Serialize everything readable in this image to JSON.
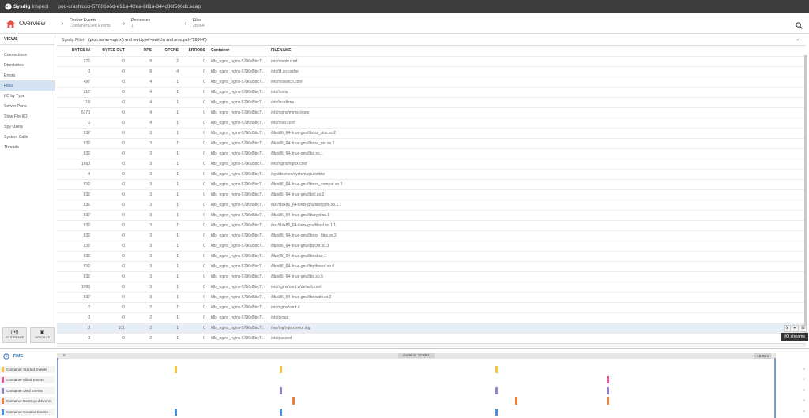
{
  "app": {
    "brand": "Sysdig",
    "subtitle": "Inspect",
    "filename": "pod-crashloop-57006e6d-e91a-42ea-881a-344c06f506dc.scap"
  },
  "nav": {
    "home_label": "Overview",
    "crumbs": [
      {
        "title": "Docker Events",
        "sub": "Container Died Events"
      },
      {
        "title": "Processes",
        "sub": "1"
      },
      {
        "title": "Files",
        "sub": "28064"
      }
    ]
  },
  "sidebar": {
    "header": "VIEWS",
    "items": [
      "Connections",
      "Directories",
      "Errors",
      "Files",
      "I/O by Type",
      "Server Ports",
      "Slow File I/O",
      "Spy Users",
      "System Calls",
      "Threads"
    ],
    "active_index": 3,
    "buttons": [
      {
        "glyph": "((•))",
        "label": "I/O STREAMS"
      },
      {
        "glyph": "▣",
        "label": "SYSCALLS"
      }
    ]
  },
  "filter": {
    "label": "Sysdig Filter",
    "value": "(proc.name=nginx ) and (evt.type!=switch) and proc.pid=\"28064\")"
  },
  "table": {
    "columns": [
      "BYTES IN",
      "BYTES OUT",
      "OPS",
      "OPENS",
      "ERRORS",
      "Container",
      "FILENAME"
    ],
    "rows": [
      [
        "276",
        "0",
        "8",
        "2",
        "0",
        "k8s_nginx_nginx-5796d5bc7...",
        "/etc/resolv.conf"
      ],
      [
        "0",
        "0",
        "8",
        "4",
        "0",
        "k8s_nginx_nginx-5796d5bc7...",
        "/etc/ld.so.cache"
      ],
      [
        "497",
        "0",
        "4",
        "1",
        "0",
        "k8s_nginx_nginx-5796d5bc7...",
        "/etc/nsswitch.conf"
      ],
      [
        "217",
        "0",
        "4",
        "1",
        "0",
        "k8s_nginx_nginx-5796d5bc7...",
        "/etc/hosts"
      ],
      [
        "118",
        "0",
        "4",
        "1",
        "0",
        "k8s_nginx_nginx-5796d5bc7...",
        "/etc/localtime"
      ],
      [
        "5170",
        "0",
        "4",
        "1",
        "0",
        "k8s_nginx_nginx-5796d5bc7...",
        "/etc/nginx/mime.types"
      ],
      [
        "0",
        "0",
        "4",
        "1",
        "0",
        "k8s_nginx_nginx-5796d5bc7...",
        "/etc/host.conf"
      ],
      [
        "832",
        "0",
        "3",
        "1",
        "0",
        "k8s_nginx_nginx-5796d5bc7...",
        "/lib/x86_64-linux-gnu/libnss_dns.so.2"
      ],
      [
        "832",
        "0",
        "3",
        "1",
        "0",
        "k8s_nginx_nginx-5796d5bc7...",
        "/lib/x86_64-linux-gnu/libnss_nis.so.2"
      ],
      [
        "832",
        "0",
        "3",
        "1",
        "0",
        "k8s_nginx_nginx-5796d5bc7...",
        "/lib/x86_64-linux-gnu/libz.so.1"
      ],
      [
        "1680",
        "0",
        "3",
        "1",
        "0",
        "k8s_nginx_nginx-5796d5bc7...",
        "/etc/nginx/nginx.conf"
      ],
      [
        "4",
        "0",
        "3",
        "1",
        "0",
        "k8s_nginx_nginx-5796d5bc7...",
        "/sys/devices/system/cpu/online"
      ],
      [
        "832",
        "0",
        "3",
        "1",
        "0",
        "k8s_nginx_nginx-5796d5bc7...",
        "/lib/x86_64-linux-gnu/libnss_compat.so.2"
      ],
      [
        "832",
        "0",
        "3",
        "1",
        "0",
        "k8s_nginx_nginx-5796d5bc7...",
        "/lib/x86_64-linux-gnu/libdl.so.2"
      ],
      [
        "832",
        "0",
        "3",
        "1",
        "0",
        "k8s_nginx_nginx-5796d5bc7...",
        "/usr/lib/x86_64-linux-gnu/libcrypto.so.1.1"
      ],
      [
        "832",
        "0",
        "3",
        "1",
        "0",
        "k8s_nginx_nginx-5796d5bc7...",
        "/lib/x86_64-linux-gnu/libcrypt.so.1"
      ],
      [
        "832",
        "0",
        "3",
        "1",
        "0",
        "k8s_nginx_nginx-5796d5bc7...",
        "/usr/lib/x86_64-linux-gnu/libssl.so.1.1"
      ],
      [
        "832",
        "0",
        "3",
        "1",
        "0",
        "k8s_nginx_nginx-5796d5bc7...",
        "/lib/x86_64-linux-gnu/libnss_files.so.2"
      ],
      [
        "832",
        "0",
        "3",
        "1",
        "0",
        "k8s_nginx_nginx-5796d5bc7...",
        "/lib/x86_64-linux-gnu/libpcre.so.3"
      ],
      [
        "832",
        "0",
        "3",
        "1",
        "0",
        "k8s_nginx_nginx-5796d5bc7...",
        "/lib/x86_64-linux-gnu/libnsl.so.1"
      ],
      [
        "832",
        "0",
        "3",
        "1",
        "0",
        "k8s_nginx_nginx-5796d5bc7...",
        "/lib/x86_64-linux-gnu/libpthread.so.0"
      ],
      [
        "832",
        "0",
        "3",
        "1",
        "0",
        "k8s_nginx_nginx-5796d5bc7...",
        "/lib/x86_64-linux-gnu/libc.so.6"
      ],
      [
        "1093",
        "0",
        "3",
        "1",
        "0",
        "k8s_nginx_nginx-5796d5bc7...",
        "/etc/nginx/conf.d/default.conf"
      ],
      [
        "832",
        "0",
        "3",
        "1",
        "0",
        "k8s_nginx_nginx-5796d5bc7...",
        "/lib/x86_64-linux-gnu/libresolv.so.2"
      ],
      [
        "0",
        "0",
        "2",
        "1",
        "0",
        "k8s_nginx_nginx-5796d5bc7...",
        "/etc/nginx/conf.d"
      ],
      [
        "0",
        "0",
        "2",
        "1",
        "0",
        "k8s_nginx_nginx-5796d5bc7...",
        "/etc/group"
      ],
      [
        "0",
        "101",
        "2",
        "1",
        "0",
        "k8s_nginx_nginx-5796d5bc7...",
        "/var/log/nginx/error.log"
      ],
      [
        "0",
        "0",
        "2",
        "1",
        "0",
        "k8s_nginx_nginx-5796d5bc7...",
        "/etc/passwd"
      ]
    ],
    "selected_row": 26,
    "row_controls": [
      "⊻",
      "⏯",
      "⊞"
    ],
    "tooltip": "I/O streams"
  },
  "timeline": {
    "header": "TIME",
    "axis_start": "0",
    "axis_mid": "duration: 10.99 s",
    "axis_end": "10.99 s",
    "rows": [
      {
        "label": "Container Started Events",
        "color": "#f5c542",
        "marks": [
          1.8,
          3.4,
          6.7
        ]
      },
      {
        "label": "Container Killed Events",
        "color": "#e6559b",
        "marks": [
          8.4
        ]
      },
      {
        "label": "Container Died Events",
        "color": "#9b7fd4",
        "marks": [
          3.4,
          6.7,
          8.4
        ]
      },
      {
        "label": "Container Destroyed Events",
        "color": "#f07f3c",
        "marks": [
          3.6,
          7.0,
          8.4
        ]
      },
      {
        "label": "Container Created Events",
        "color": "#4a8fe0",
        "marks": [
          1.8,
          3.4,
          6.7
        ]
      }
    ]
  }
}
